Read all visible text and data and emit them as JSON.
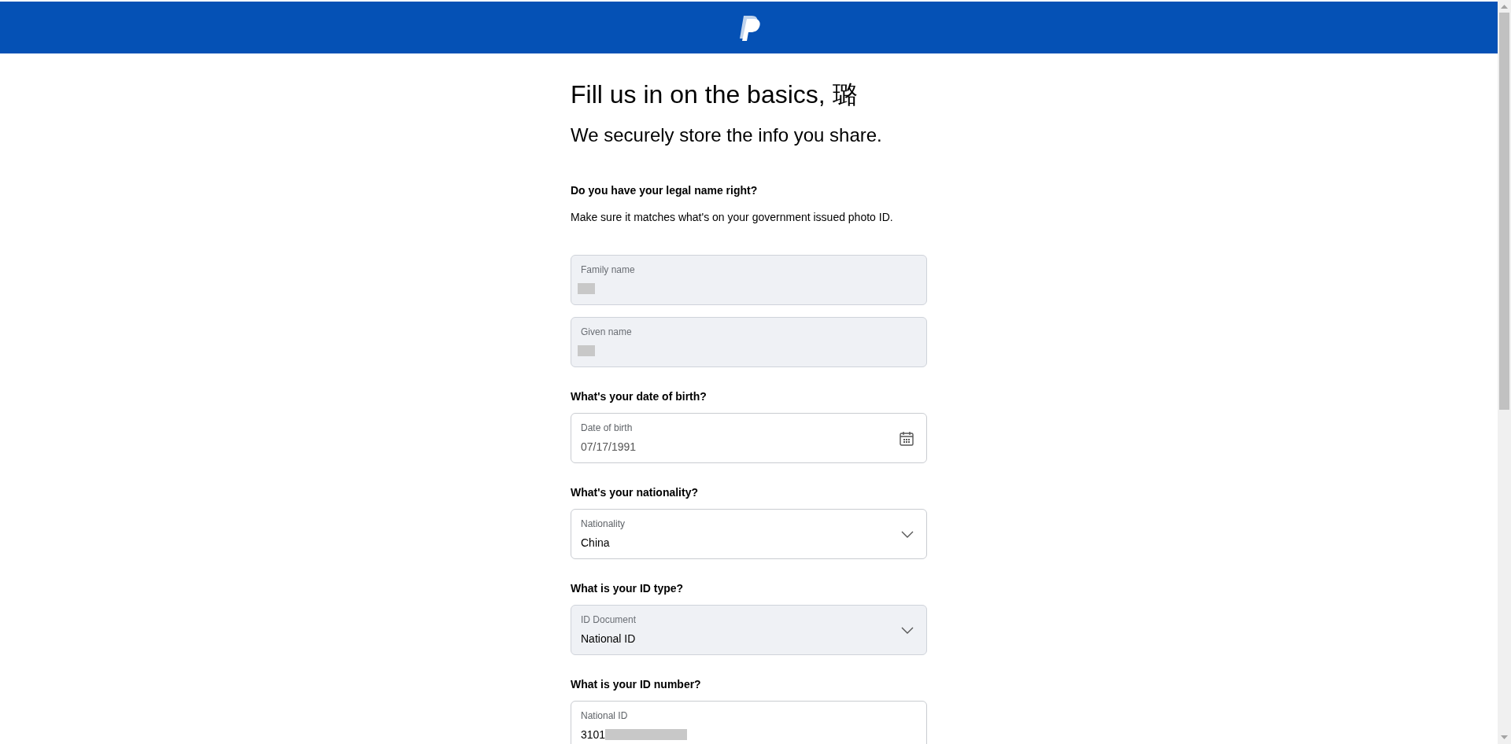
{
  "title": "Fill us in on the basics, 璐",
  "subtitle": "We securely store the info you share.",
  "sections": [
    {
      "question": "Do you have your legal name right?",
      "description": "Make sure it matches what's on your government issued photo ID.",
      "fields": [
        {
          "kind": "text",
          "label": "Family name",
          "disabled": true,
          "redacted": true
        },
        {
          "kind": "text",
          "label": "Given name",
          "disabled": true,
          "redacted": true
        }
      ]
    },
    {
      "question": "What's your date of birth?",
      "fields": [
        {
          "kind": "date",
          "label": "Date of birth",
          "value": "07/17/1991",
          "disabled": false,
          "redacted": false
        }
      ]
    },
    {
      "question": "What's your nationality?",
      "fields": [
        {
          "kind": "select",
          "label": "Nationality",
          "value": "China",
          "disabled": false,
          "redacted": false
        }
      ]
    },
    {
      "question": "What is your ID type?",
      "fields": [
        {
          "kind": "select",
          "label": "ID Document",
          "value": "National ID",
          "disabled": true,
          "redacted": false
        }
      ]
    },
    {
      "question": "What is your ID number?",
      "fields": [
        {
          "kind": "text",
          "label": "National ID",
          "value": "3101",
          "disabled": false,
          "redacted": true
        }
      ]
    }
  ]
}
